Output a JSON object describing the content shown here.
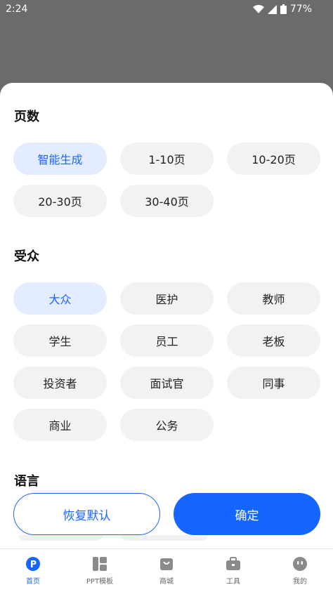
{
  "status_bar": {
    "time": "2:24",
    "battery": "77%"
  },
  "sections": {
    "pages": {
      "title": "页数",
      "options": [
        {
          "label": "智能生成",
          "selected": true
        },
        {
          "label": "1-10页",
          "selected": false
        },
        {
          "label": "10-20页",
          "selected": false
        },
        {
          "label": "20-30页",
          "selected": false
        },
        {
          "label": "30-40页",
          "selected": false
        }
      ]
    },
    "audience": {
      "title": "受众",
      "options": [
        {
          "label": "大众",
          "selected": true
        },
        {
          "label": "医护",
          "selected": false
        },
        {
          "label": "教师",
          "selected": false
        },
        {
          "label": "学生",
          "selected": false
        },
        {
          "label": "员工",
          "selected": false
        },
        {
          "label": "老板",
          "selected": false
        },
        {
          "label": "投资者",
          "selected": false
        },
        {
          "label": "面试官",
          "selected": false
        },
        {
          "label": "同事",
          "selected": false
        },
        {
          "label": "商业",
          "selected": false
        },
        {
          "label": "公务",
          "selected": false
        }
      ]
    },
    "language": {
      "title": "语言"
    }
  },
  "buttons": {
    "reset": "恢复默认",
    "confirm": "确定"
  },
  "tabbar": {
    "items": [
      {
        "label": "首页",
        "icon": "home-p-icon",
        "active": true
      },
      {
        "label": "PPT模板",
        "icon": "template-icon",
        "active": false
      },
      {
        "label": "商城",
        "icon": "shopping-bag-icon",
        "active": false
      },
      {
        "label": "工具",
        "icon": "toolbox-icon",
        "active": false
      },
      {
        "label": "我的",
        "icon": "profile-face-icon",
        "active": false
      }
    ]
  },
  "colors": {
    "accent": "#1466ff",
    "chip_bg": "#f2f2f2",
    "chip_selected_bg": "#e3edff"
  }
}
